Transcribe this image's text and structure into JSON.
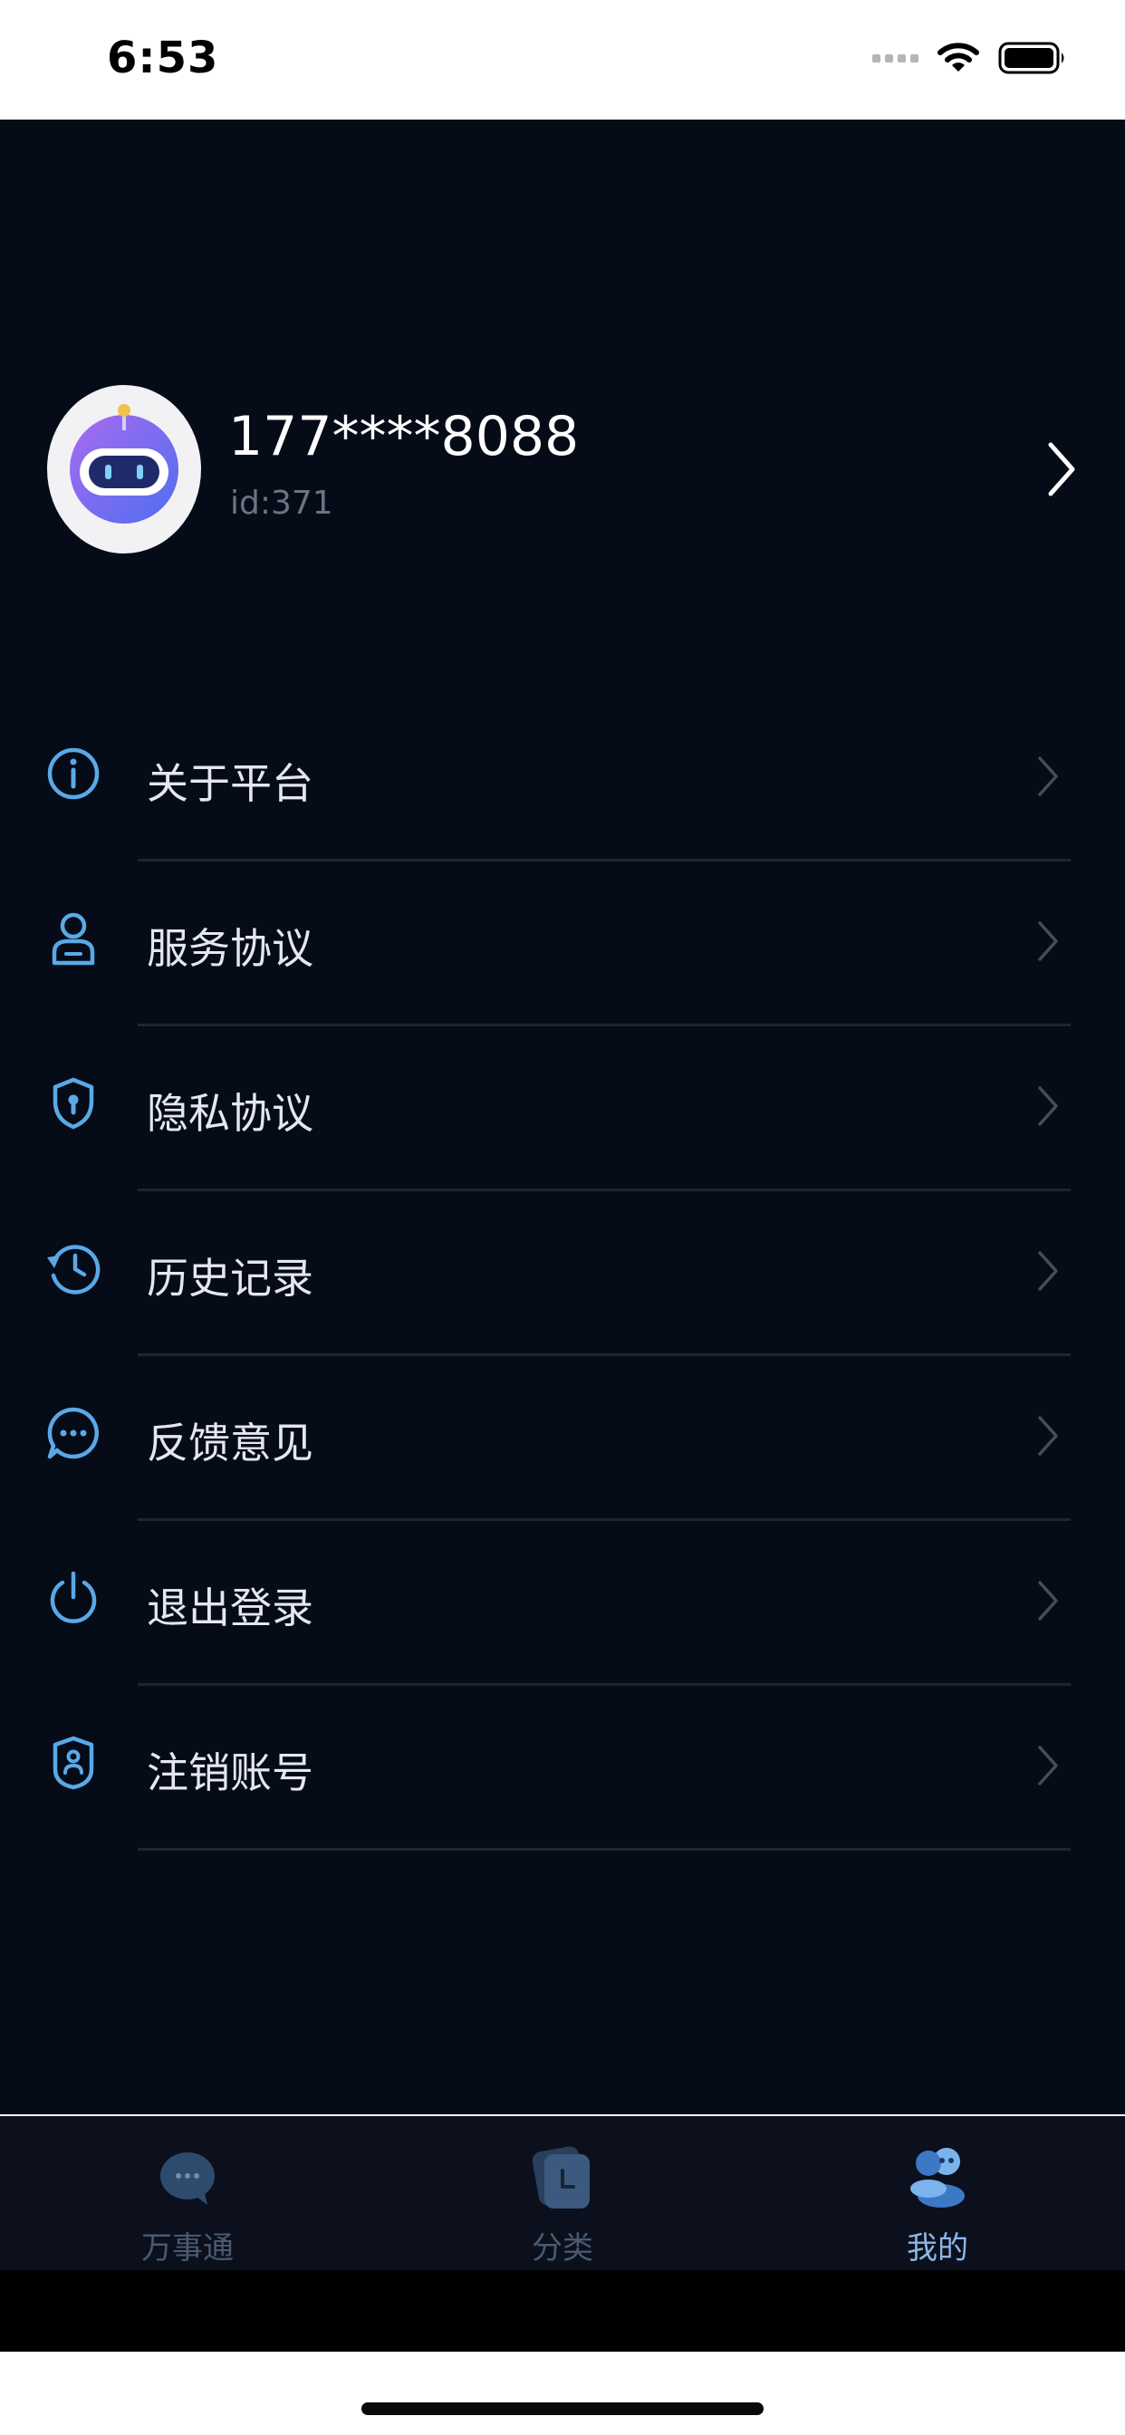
{
  "status_bar": {
    "time": "6:53"
  },
  "profile": {
    "name": "177****8088",
    "id_label": "id:371"
  },
  "menu": [
    {
      "label": "关于平台",
      "icon": "info-icon"
    },
    {
      "label": "服务协议",
      "icon": "user-icon"
    },
    {
      "label": "隐私协议",
      "icon": "shield-lock-icon"
    },
    {
      "label": "历史记录",
      "icon": "history-icon"
    },
    {
      "label": "反馈意见",
      "icon": "chat-icon"
    },
    {
      "label": "退出登录",
      "icon": "power-icon"
    },
    {
      "label": "注销账号",
      "icon": "shield-user-icon"
    }
  ],
  "tabs": [
    {
      "label": "万事通",
      "icon": "chat-bubble-icon",
      "active": false
    },
    {
      "label": "分类",
      "icon": "category-icon",
      "active": false
    },
    {
      "label": "我的",
      "icon": "profile-icon",
      "active": true
    }
  ],
  "colors": {
    "background": "#060b18",
    "accent": "#5aa9e6",
    "active_tab": "#8fb6e6"
  }
}
